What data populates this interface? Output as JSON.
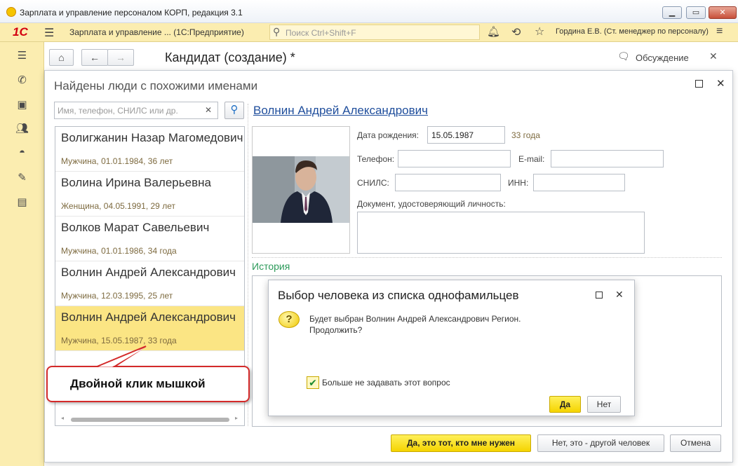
{
  "window": {
    "title": "Зарплата и управление персоналом КОРП, редакция 3.1",
    "minimize": "▁",
    "restore": "▭",
    "close": "✕"
  },
  "appbar": {
    "logo": "1С",
    "app_name": "Зарплата и управление ...  (1С:Предприятие)",
    "search_placeholder": "Поиск Ctrl+Shift+F",
    "user": "Гордина Е.В. (Ст. менеджер по персоналу)"
  },
  "doc": {
    "title": "Кандидат (создание) *",
    "discussion": "Обсуждение"
  },
  "dialog": {
    "title": "Найдены люди с похожими именами",
    "search_placeholder": "Имя, телефон, СНИЛС или др.",
    "items": [
      {
        "name": "Волигжанин Назар Магомедович",
        "info": "Мужчина, 01.01.1984, 36 лет"
      },
      {
        "name": "Волина Ирина Валерьевна",
        "info": "Женщина, 04.05.1991, 29 лет"
      },
      {
        "name": "Волков Марат Савельевич",
        "info": "Мужчина, 01.01.1986, 34 года"
      },
      {
        "name": "Волнин Андрей Александрович",
        "info": "Мужчина, 12.03.1995, 25 лет"
      },
      {
        "name": "Волнин Андрей Александрович",
        "info": "Мужчина, 15.05.1987, 33 года"
      }
    ],
    "person": {
      "name": "Волнин Андрей Александрович",
      "birth_label": "Дата рождения:",
      "birth_value": "15.05.1987",
      "age": "33 года",
      "phone_label": "Телефон:",
      "email_label": "E-mail:",
      "snils_label": "СНИЛС:",
      "inn_label": "ИНН:",
      "doc_label": "Документ, удостоверяющий личность:"
    },
    "history_label": "История",
    "buttons": {
      "yes": "Да, это тот, кто мне нужен",
      "no": "Нет, это - другой человек",
      "cancel": "Отмена"
    }
  },
  "confirm": {
    "title": "Выбор человека из списка однофамильцев",
    "message_line1": "Будет выбран Волнин Андрей Александрович Регион.",
    "message_line2": "Продолжить?",
    "checkbox_label": "Больше не задавать этот вопрос",
    "checkbox_checked": true,
    "yes": "Да",
    "no": "Нет"
  },
  "callout": {
    "text": "Двойной клик мышкой"
  },
  "colors": {
    "accent_yellow": "#fbedb0",
    "link_blue": "#1f4e9c",
    "history_green": "#2c9a5a",
    "callout_red": "#d42a2a"
  }
}
